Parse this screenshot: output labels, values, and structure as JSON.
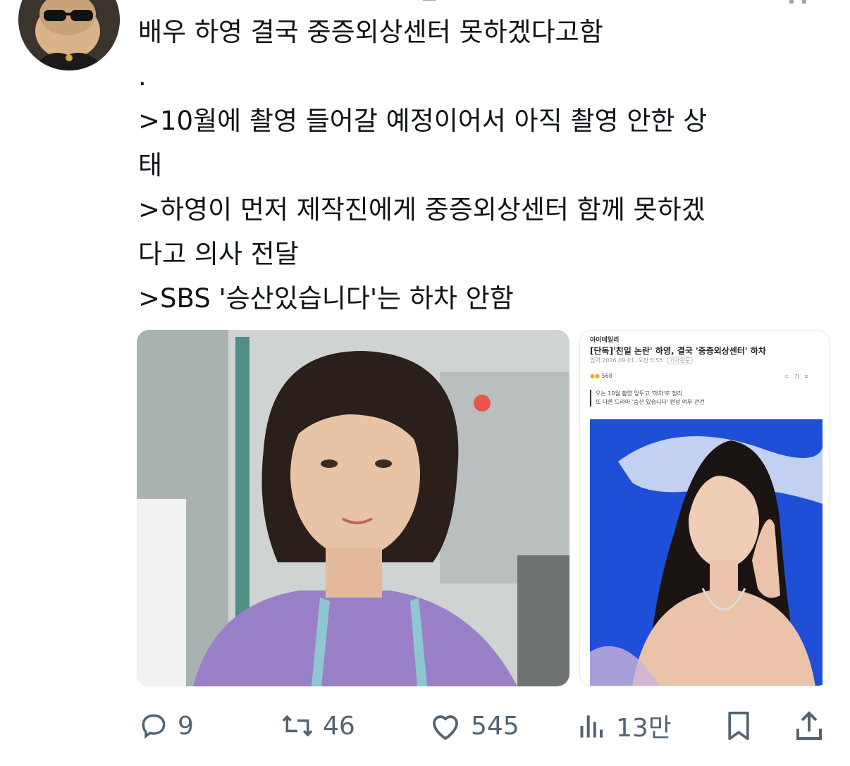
{
  "tweet": {
    "lines": [
      "배우 하영 결국 중증외상센터 못하겠다고함",
      ".",
      ">10월에 촬영 들어갈 예정이어서 아직 촬영 안한 상",
      "태",
      ">하영이 먼저 제작진에게 중증외상센터 함께 못하겠",
      "다고 의사 전달",
      ">SBS '승산있습니다'는 하차 안함"
    ]
  },
  "news_card": {
    "logo": "아이데일리",
    "headline": "[단독]'친일 논란' 하영, 결국 '중증외상센터' 하차",
    "meta": "입력 2026.09.01. 오전 5:55",
    "meta_badge": "기사원문",
    "reaction_count": "568",
    "tools": "ㄷ 가 ㄸ",
    "summary": [
      "오는 10월 촬영 앞두고 '하차'로 정리",
      "또 다른 드라마 '승산 있습니다' 편성 여부 관건"
    ]
  },
  "actions": {
    "replies": "9",
    "retweets": "46",
    "likes": "545",
    "views": "13만"
  },
  "colors": {
    "text": "#0f1419",
    "icon": "#536471",
    "scrub_purple": "#9a80c8",
    "event_blue": "#1f4fd6"
  }
}
